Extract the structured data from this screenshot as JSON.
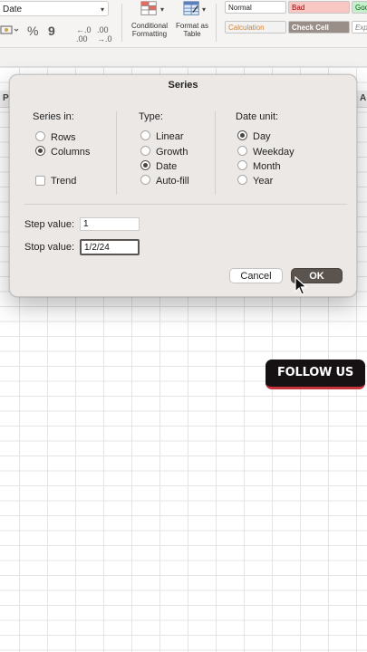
{
  "ribbon": {
    "number_format": "Date",
    "format_buttons": [
      "%",
      "9",
      "←.0 .00",
      ".00 →.0"
    ],
    "conditional_formatting": "Conditional Formatting",
    "format_as_table": "Format as Table",
    "styles": [
      {
        "label": "Normal",
        "bg": "#ffffff",
        "fg": "#222222"
      },
      {
        "label": "Bad",
        "bg": "#f8c6c3",
        "fg": "#9c0006"
      },
      {
        "label": "Goo",
        "bg": "#c6efce",
        "fg": "#006100"
      },
      {
        "label": "Calculation",
        "bg": "#f2f2f2",
        "fg": "#d9822b"
      },
      {
        "label": "Check Cell",
        "bg": "#9a8f88",
        "fg": "#ffffff"
      },
      {
        "label": "Exp",
        "bg": "#ffffff",
        "fg": "#7f7f7f"
      }
    ]
  },
  "columns": [
    "P",
    "A"
  ],
  "dialog": {
    "title": "Series",
    "series_in": {
      "title": "Series in:",
      "options": [
        {
          "label": "Rows",
          "selected": false
        },
        {
          "label": "Columns",
          "selected": true
        }
      ],
      "trend_label": "Trend",
      "trend_checked": false
    },
    "type": {
      "title": "Type:",
      "options": [
        {
          "label": "Linear",
          "selected": false
        },
        {
          "label": "Growth",
          "selected": false
        },
        {
          "label": "Date",
          "selected": true
        },
        {
          "label": "Auto-fill",
          "selected": false
        }
      ]
    },
    "date_unit": {
      "title": "Date unit:",
      "options": [
        {
          "label": "Day",
          "selected": true
        },
        {
          "label": "Weekday",
          "selected": false
        },
        {
          "label": "Month",
          "selected": false
        },
        {
          "label": "Year",
          "selected": false
        }
      ]
    },
    "step_value_label": "Step value:",
    "step_value": "1",
    "stop_value_label": "Stop value:",
    "stop_value": "1/2/24",
    "cancel_label": "Cancel",
    "ok_label": "OK"
  },
  "overlay": {
    "follow_label": "FOLLOW US"
  }
}
